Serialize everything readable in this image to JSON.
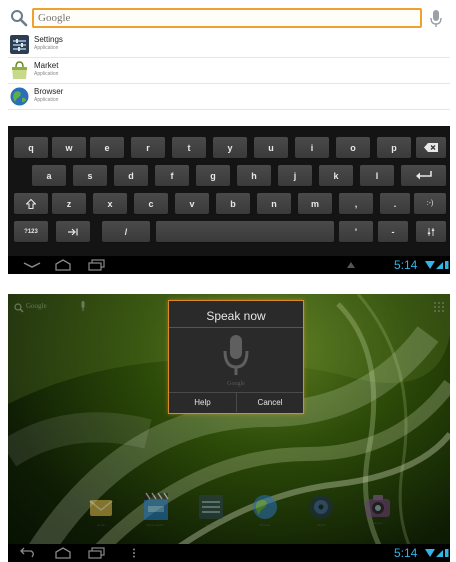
{
  "top": {
    "search": {
      "placeholder": "Google"
    },
    "suggestions": [
      {
        "title": "Settings",
        "subtitle": "Application",
        "icon": "settings-icon"
      },
      {
        "title": "Market",
        "subtitle": "Application",
        "icon": "market-icon"
      },
      {
        "title": "Browser",
        "subtitle": "Application",
        "icon": "browser-icon"
      }
    ],
    "keyboard": {
      "row1": [
        "q",
        "w",
        "e",
        "r",
        "t",
        "y",
        "u",
        "i",
        "o",
        "p"
      ],
      "row2": [
        "a",
        "s",
        "d",
        "f",
        "g",
        "h",
        "j",
        "k",
        "l"
      ],
      "row3": [
        "z",
        "x",
        "c",
        "v",
        "b",
        "n",
        "m",
        ",",
        "."
      ],
      "sym_key": "?123",
      "slash_key": "/",
      "apostrophe_key": "'",
      "dash_key": "-",
      "smiley_key": ":-)"
    },
    "clock": "5:14"
  },
  "bottom": {
    "search_label": "Google",
    "dialog": {
      "title": "Speak now",
      "caption": "Google",
      "help": "Help",
      "cancel": "Cancel"
    },
    "dock_apps": [
      {
        "name": "Email",
        "icon": "email-icon"
      },
      {
        "name": "Movie Studio",
        "icon": "movie-studio-icon"
      },
      {
        "name": "Settings",
        "icon": "settings-icon"
      },
      {
        "name": "Browser",
        "icon": "browser-icon"
      },
      {
        "name": "Music",
        "icon": "music-icon"
      },
      {
        "name": "Camera",
        "icon": "camera-icon"
      }
    ],
    "clock": "5:14"
  },
  "colors": {
    "accent": "#33b5e5",
    "focus": "#f0a030"
  }
}
